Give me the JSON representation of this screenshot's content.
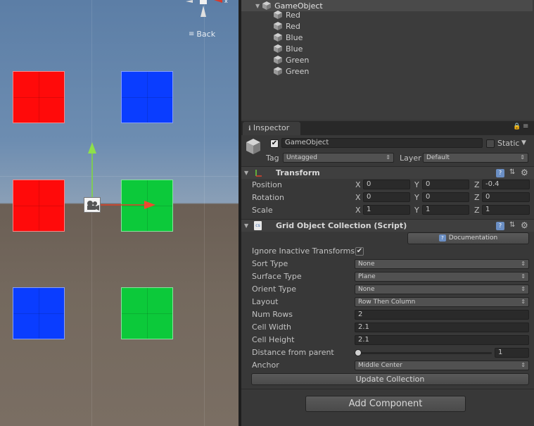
{
  "scene": {
    "back_label": "Back",
    "quads": [
      {
        "color": "Red"
      },
      {
        "color": "Blue"
      },
      {
        "color": "Red"
      },
      {
        "color": "Green"
      },
      {
        "color": "Blue"
      },
      {
        "color": "Green"
      }
    ]
  },
  "hierarchy": {
    "root": "GameObject",
    "children": [
      "Red",
      "Red",
      "Blue",
      "Blue",
      "Green",
      "Green"
    ]
  },
  "inspector": {
    "tab": "Inspector",
    "object_name": "GameObject",
    "active": true,
    "static_label": "Static",
    "static": false,
    "tag_label": "Tag",
    "tag_value": "Untagged",
    "layer_label": "Layer",
    "layer_value": "Default"
  },
  "transform": {
    "title": "Transform",
    "position": {
      "label": "Position",
      "x": "0",
      "y": "0",
      "z": "-0.4"
    },
    "rotation": {
      "label": "Rotation",
      "x": "0",
      "y": "0",
      "z": "0"
    },
    "scale": {
      "label": "Scale",
      "x": "1",
      "y": "1",
      "z": "1"
    },
    "axis_x": "X",
    "axis_y": "Y",
    "axis_z": "Z"
  },
  "grid": {
    "title": "Grid Object Collection (Script)",
    "documentation": "Documentation",
    "ignore_inactive_label": "Ignore Inactive Transforms",
    "ignore_inactive": true,
    "sort_type_label": "Sort Type",
    "sort_type": "None",
    "surface_type_label": "Surface Type",
    "surface_type": "Plane",
    "orient_type_label": "Orient Type",
    "orient_type": "None",
    "layout_label": "Layout",
    "layout": "Row Then Column",
    "num_rows_label": "Num Rows",
    "num_rows": "2",
    "cell_width_label": "Cell Width",
    "cell_width": "2.1",
    "cell_height_label": "Cell Height",
    "cell_height": "2.1",
    "distance_label": "Distance from parent",
    "distance": "1",
    "anchor_label": "Anchor",
    "anchor": "Middle Center",
    "update_button": "Update Collection"
  },
  "add_component": "Add Component",
  "colors": {
    "red": "#ff0a0a",
    "blue": "#0a3dff",
    "green": "#0cc93a",
    "panel": "#383838"
  }
}
